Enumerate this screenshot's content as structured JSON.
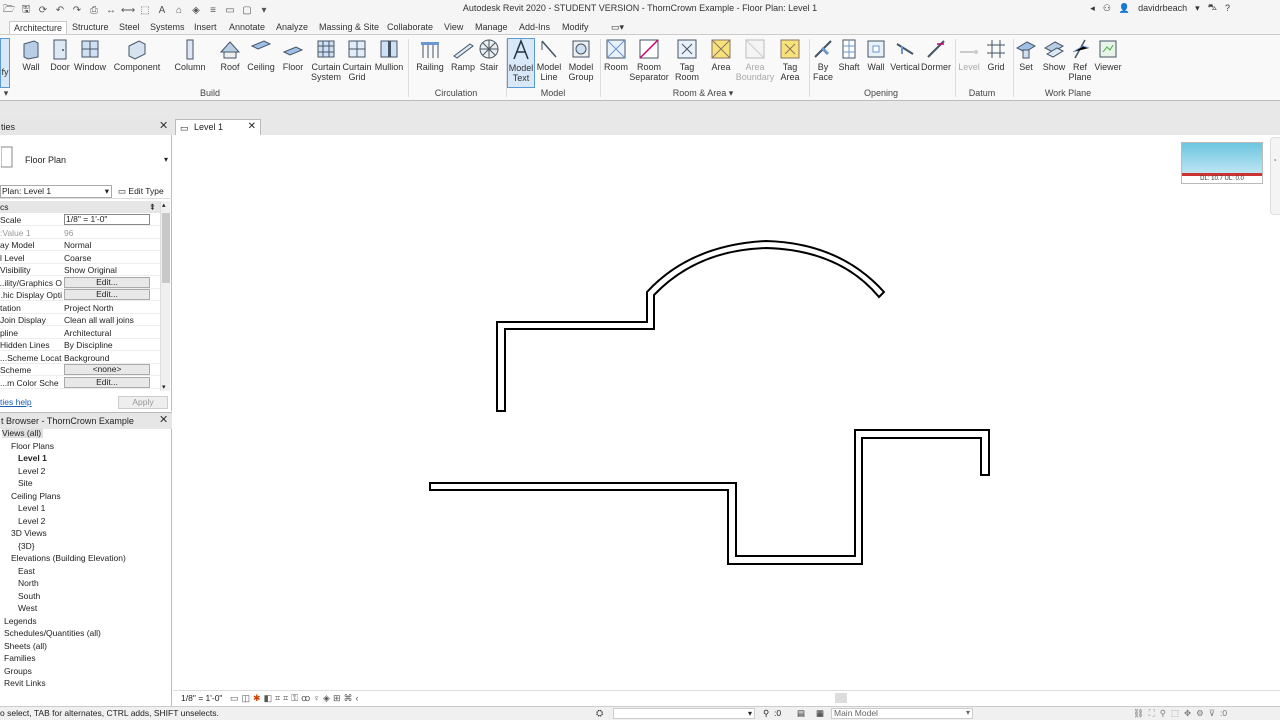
{
  "title": "Autodesk Revit 2020 - STUDENT VERSION - ThornCrown Example - Floor Plan: Level 1",
  "user": "davidrbeach",
  "tabs": [
    "Architecture",
    "Structure",
    "Steel",
    "Systems",
    "Insert",
    "Annotate",
    "Analyze",
    "Massing & Site",
    "Collaborate",
    "View",
    "Manage",
    "Add-Ins",
    "Modify"
  ],
  "ribbon": {
    "modify_label": "fy",
    "buttons": {
      "wall": "Wall",
      "door": "Door",
      "window": "Window",
      "component": "Component",
      "column": "Column",
      "roof": "Roof",
      "ceiling": "Ceiling",
      "floor": "Floor",
      "curtain_system": "Curtain\nSystem",
      "curtain_grid": "Curtain\nGrid",
      "mullion": "Mullion",
      "railing": "Railing",
      "ramp": "Ramp",
      "stair": "Stair",
      "model_text": "Model\nText",
      "model_line": "Model\nLine",
      "model_group": "Model\nGroup",
      "room": "Room",
      "room_separator": "Room\nSeparator",
      "tag_room": "Tag\nRoom",
      "area": "Area",
      "area_boundary": "Area\nBoundary",
      "tag_area": "Tag\nArea",
      "by_face": "By\nFace",
      "shaft": "Shaft",
      "wall_opening": "Wall",
      "vertical": "Vertical",
      "dormer": "Dormer",
      "level": "Level",
      "grid": "Grid",
      "set": "Set",
      "show": "Show",
      "ref_plane": "Ref\nPlane",
      "viewer": "Viewer"
    },
    "panels": {
      "build": "Build",
      "circulation": "Circulation",
      "model": "Model",
      "room_area": "Room & Area",
      "opening": "Opening",
      "datum": "Datum",
      "work_plane": "Work Plane"
    }
  },
  "properties": {
    "header": "ties",
    "type_name": "Floor Plan",
    "instance_filter": "Plan: Level 1",
    "edit_type": "Edit Type",
    "section": "cs",
    "rows": [
      {
        "k": "Scale",
        "v": "1/8\" = 1'-0\"",
        "kind": "input"
      },
      {
        "k": "Value 1:",
        "v": "96",
        "kind": "gray"
      },
      {
        "k": "ay Model",
        "v": "Normal",
        "kind": "text"
      },
      {
        "k": "l Level",
        "v": "Coarse",
        "kind": "text"
      },
      {
        "k": "Visibility",
        "v": "Show Original",
        "kind": "text"
      },
      {
        "k": "ility/Graphics O...",
        "v": "Edit...",
        "kind": "button"
      },
      {
        "k": "hic Display Opti...",
        "v": "Edit...",
        "kind": "button"
      },
      {
        "k": "tation",
        "v": "Project North",
        "kind": "text"
      },
      {
        "k": "Join Display",
        "v": "Clean all wall joins",
        "kind": "text"
      },
      {
        "k": "pline",
        "v": "Architectural",
        "kind": "text"
      },
      {
        "k": "Hidden Lines",
        "v": "By Discipline",
        "kind": "text"
      },
      {
        "k": "Scheme Locat...",
        "v": "Background",
        "kind": "text"
      },
      {
        "k": "Scheme",
        "v": "<none>",
        "kind": "button"
      },
      {
        "k": "m Color Sche...",
        "v": "Edit...",
        "kind": "button"
      }
    ],
    "help_link": "ties help",
    "apply": "Apply"
  },
  "browser": {
    "header": "t Browser - ThornCrown Example",
    "items": [
      {
        "label": "Views (all)",
        "indent": 0,
        "bold": false
      },
      {
        "label": "Floor Plans",
        "indent": 1,
        "bold": false
      },
      {
        "label": "Level 1",
        "indent": 2,
        "bold": true
      },
      {
        "label": "Level 2",
        "indent": 2,
        "bold": false
      },
      {
        "label": "Site",
        "indent": 2,
        "bold": false
      },
      {
        "label": "Ceiling Plans",
        "indent": 1,
        "bold": false
      },
      {
        "label": "Level 1",
        "indent": 2,
        "bold": false
      },
      {
        "label": "Level 2",
        "indent": 2,
        "bold": false
      },
      {
        "label": "3D Views",
        "indent": 1,
        "bold": false
      },
      {
        "label": "{3D}",
        "indent": 2,
        "bold": false
      },
      {
        "label": "Elevations (Building Elevation)",
        "indent": 1,
        "bold": false
      },
      {
        "label": "East",
        "indent": 2,
        "bold": false
      },
      {
        "label": "North",
        "indent": 2,
        "bold": false
      },
      {
        "label": "South",
        "indent": 2,
        "bold": false
      },
      {
        "label": "West",
        "indent": 2,
        "bold": false
      },
      {
        "label": "Legends",
        "indent": 0,
        "bold": false
      },
      {
        "label": "Schedules/Quantities (all)",
        "indent": 0,
        "bold": false
      },
      {
        "label": "Sheets (all)",
        "indent": 0,
        "bold": false
      },
      {
        "label": "Families",
        "indent": 0,
        "bold": false
      },
      {
        "label": "Groups",
        "indent": 0,
        "bold": false
      },
      {
        "label": "Revit Links",
        "indent": 0,
        "bold": false
      }
    ]
  },
  "view_tab": "Level 1",
  "navcube_label": "DL: 10.7 UL: 0.0",
  "viewbar_scale": "1/8\" = 1'-0\"",
  "status": {
    "message": "o select, TAB for alternates, CTRL adds, SHIFT unselects.",
    "count": ":0",
    "model": "Main Model"
  },
  "colors": {
    "accent": "#5b9bd5",
    "wall": "#000000"
  }
}
